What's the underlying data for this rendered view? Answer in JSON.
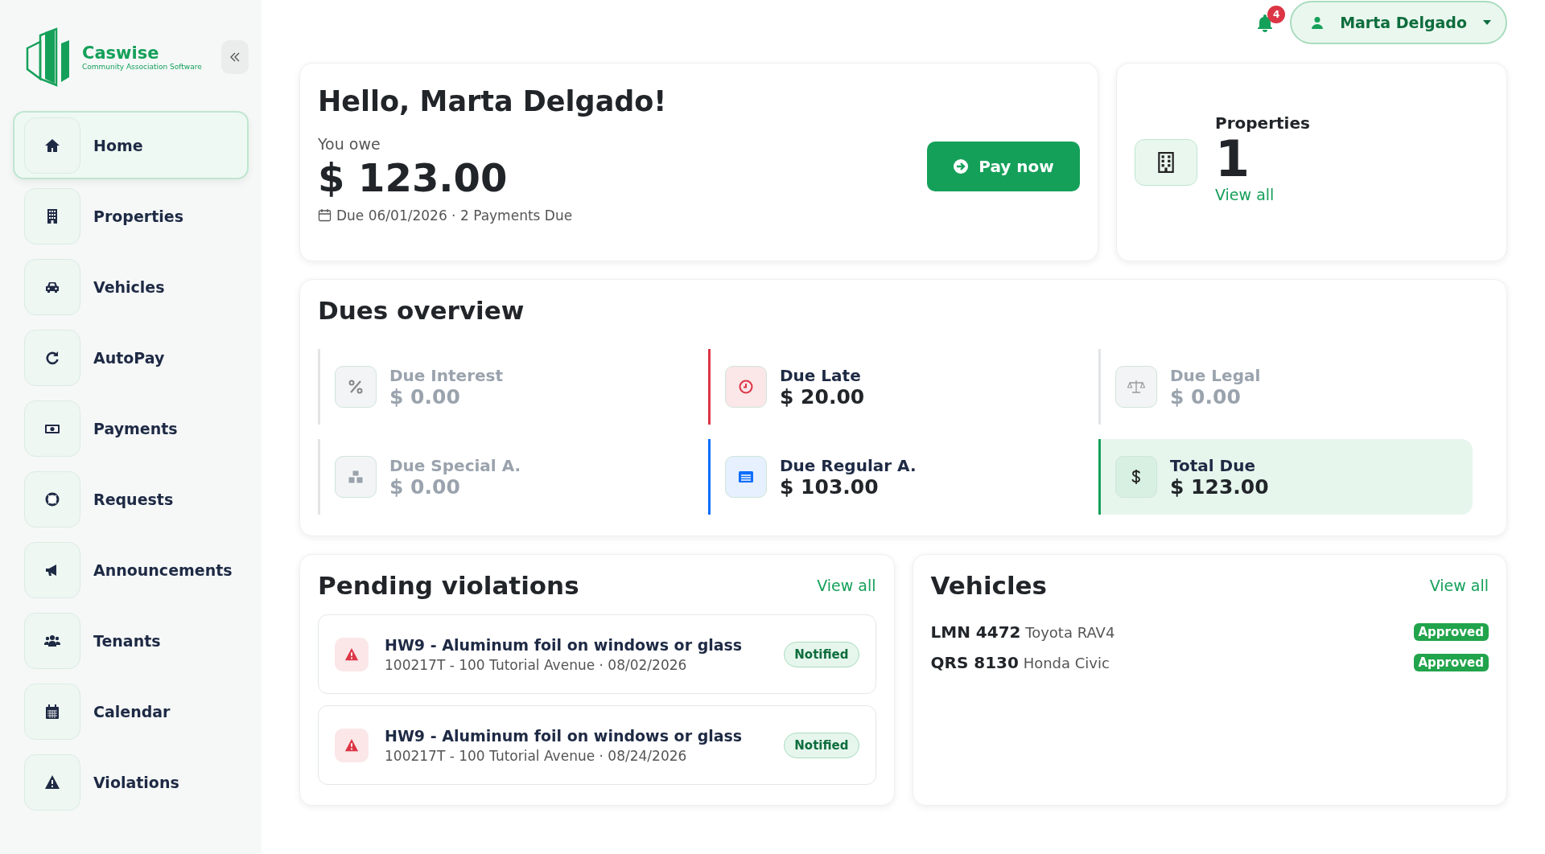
{
  "brand": {
    "name": "Caswise",
    "tagline": "Community Association Software"
  },
  "sidebar": {
    "items": [
      {
        "kind": "home",
        "label": "Home",
        "selected": true
      },
      {
        "kind": "building",
        "label": "Properties",
        "selected": false
      },
      {
        "kind": "car",
        "label": "Vehicles",
        "selected": false
      },
      {
        "kind": "refresh",
        "label": "AutoPay",
        "selected": false
      },
      {
        "kind": "money",
        "label": "Payments",
        "selected": false
      },
      {
        "kind": "lifebuoy",
        "label": "Requests",
        "selected": false
      },
      {
        "kind": "megaphone",
        "label": "Announcements",
        "selected": false
      },
      {
        "kind": "users",
        "label": "Tenants",
        "selected": false
      },
      {
        "kind": "calendar",
        "label": "Calendar",
        "selected": false
      },
      {
        "kind": "warning",
        "label": "Violations",
        "selected": false
      }
    ]
  },
  "header": {
    "notifications": "4",
    "user": "Marta Delgado"
  },
  "greeting": {
    "title": "Hello, Marta Delgado!",
    "owe_label": "You owe",
    "amount": "$ 123.00",
    "due": "Due 06/01/2026 · 2 Payments Due",
    "pay_button": "Pay now"
  },
  "properties": {
    "title": "Properties",
    "count": "1",
    "link": "View all"
  },
  "dues": {
    "title": "Dues overview",
    "items": [
      {
        "kind": "interest",
        "label": "Due Interest",
        "amount": "$ 0.00",
        "color": "#e2e4e6",
        "muted": true
      },
      {
        "kind": "late",
        "label": "Due Late",
        "amount": "$ 20.00",
        "color": "#dc3545",
        "muted": false
      },
      {
        "kind": "legal",
        "label": "Due Legal",
        "amount": "$ 0.00",
        "color": "#e2e4e6",
        "muted": true
      },
      {
        "kind": "special",
        "label": "Due Special A.",
        "amount": "$ 0.00",
        "color": "#e2e4e6",
        "muted": true
      },
      {
        "kind": "regular",
        "label": "Due Regular A.",
        "amount": "$ 103.00",
        "color": "#0d6efd",
        "muted": false
      },
      {
        "kind": "total",
        "label": "Total Due",
        "amount": "$ 123.00",
        "color": "#15a05a",
        "muted": false
      }
    ]
  },
  "violations": {
    "title": "Pending violations",
    "link": "View all",
    "items": [
      {
        "title": "HW9 - Aluminum foil on windows or glass",
        "detail": "100217T - 100 Tutorial Avenue · 08/02/2026",
        "status": "Notified"
      },
      {
        "title": "HW9 - Aluminum foil on windows or glass",
        "detail": "100217T - 100 Tutorial Avenue · 08/24/2026",
        "status": "Notified"
      }
    ]
  },
  "vehicles": {
    "title": "Vehicles",
    "link": "View all",
    "items": [
      {
        "plate": "LMN 4472",
        "model": "Toyota RAV4",
        "status": "Approved"
      },
      {
        "plate": "QRS 8130",
        "model": "Honda Civic",
        "status": "Approved"
      }
    ]
  }
}
